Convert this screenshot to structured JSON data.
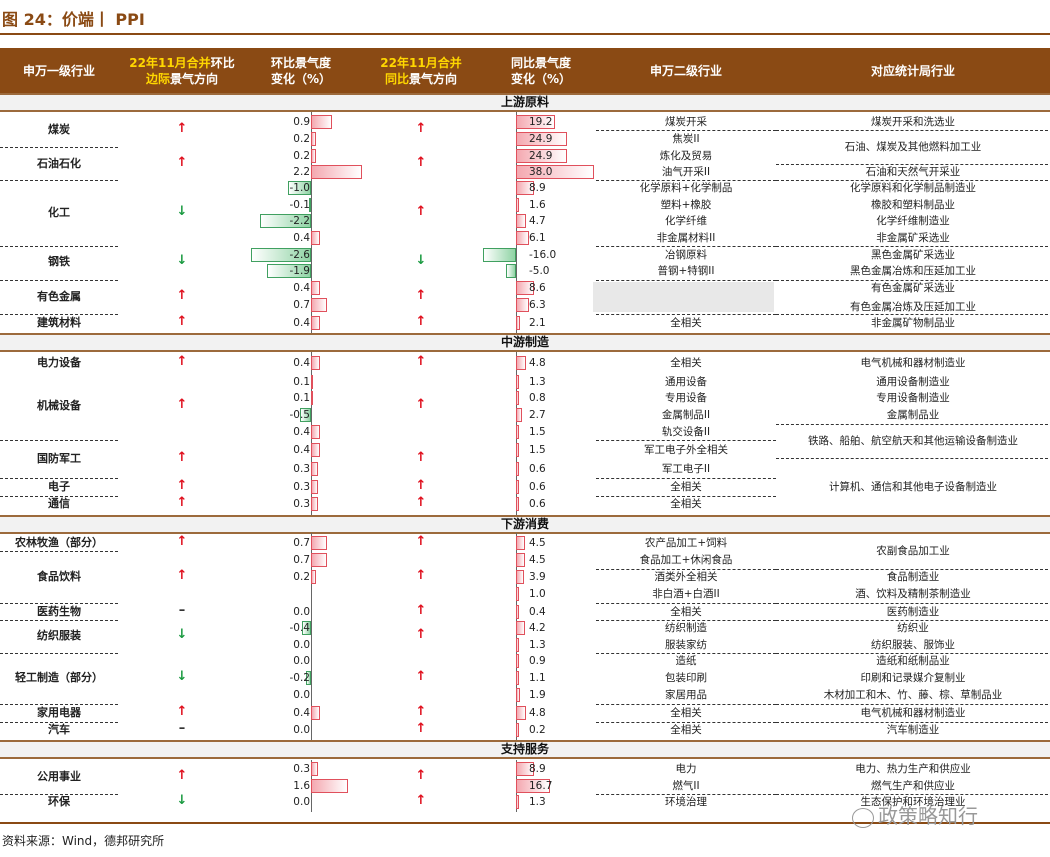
{
  "title": "图 24：价端丨 PPI",
  "footer": "资料来源：Wind，德邦研究所",
  "watermark": "政策略知行",
  "headers": [
    {
      "parts": [
        {
          "t": "申万一级行业",
          "hl": false
        }
      ]
    },
    {
      "parts": [
        {
          "t": "22年11月合并",
          "hl": true
        },
        {
          "t": "环比\n",
          "hl": false
        },
        {
          "t": "边际",
          "hl": true
        },
        {
          "t": "景气方向",
          "hl": false
        }
      ]
    },
    {
      "parts": [
        {
          "t": "环比景气度\n变化（%）",
          "hl": false
        }
      ]
    },
    {
      "parts": [
        {
          "t": "22年11月合并\n",
          "hl": true
        },
        {
          "t": "同比",
          "hl": true
        },
        {
          "t": "景气方向",
          "hl": false
        }
      ]
    },
    {
      "parts": [
        {
          "t": "同比景气度\n变化（%）",
          "hl": false
        }
      ]
    },
    {
      "parts": [
        {
          "t": "申万二级行业",
          "hl": false
        }
      ]
    },
    {
      "parts": [
        {
          "t": "对应统计局行业",
          "hl": false
        }
      ]
    }
  ],
  "sections": [
    "上游原料",
    "中游制造",
    "下游消费",
    "支持服务"
  ],
  "level1": [
    {
      "name": "煤炭",
      "mom": "up",
      "yoy": "up"
    },
    {
      "name": "石油石化",
      "mom": "up",
      "yoy": "up"
    },
    {
      "name": "化工",
      "mom": "down",
      "yoy": "up"
    },
    {
      "name": "钢铁",
      "mom": "down",
      "yoy": "down"
    },
    {
      "name": "有色金属",
      "mom": "up",
      "yoy": "up"
    },
    {
      "name": "建筑材料",
      "mom": "up",
      "yoy": "up"
    },
    {
      "name": "电力设备",
      "mom": "up",
      "yoy": "up"
    },
    {
      "name": "机械设备",
      "mom": "up",
      "yoy": "up"
    },
    {
      "name": "国防军工",
      "mom": "up",
      "yoy": "up"
    },
    {
      "name": "电子",
      "mom": "up",
      "yoy": "up"
    },
    {
      "name": "通信",
      "mom": "up",
      "yoy": "up"
    },
    {
      "name": "农林牧渔（部分）",
      "mom": "up",
      "yoy": "up"
    },
    {
      "name": "食品饮料",
      "mom": "up",
      "yoy": "up"
    },
    {
      "name": "医药生物",
      "mom": "flat",
      "yoy": "up"
    },
    {
      "name": "纺织服装",
      "mom": "down",
      "yoy": "up"
    },
    {
      "name": "轻工制造（部分）",
      "mom": "down",
      "yoy": "up"
    },
    {
      "name": "家用电器",
      "mom": "up",
      "yoy": "up"
    },
    {
      "name": "汽车",
      "mom": "flat",
      "yoy": "up"
    },
    {
      "name": "公用事业",
      "mom": "up",
      "yoy": "up"
    },
    {
      "name": "环保",
      "mom": "down",
      "yoy": "up"
    }
  ],
  "arrow_glyphs": {
    "up": "↑",
    "down": "↓",
    "flat": "–"
  },
  "level2": [
    {
      "mom": 0.9,
      "mom_label": "0.9",
      "yoy": 19.2,
      "yoy_label": "19.2",
      "name": "煤炭开采"
    },
    {
      "mom": 0.2,
      "mom_label": "0.2",
      "yoy": 24.9,
      "yoy_label": "24.9",
      "name": "焦炭II"
    },
    {
      "mom": 0.2,
      "mom_label": "0.2",
      "yoy": 24.9,
      "yoy_label": "24.9",
      "name": "炼化及贸易"
    },
    {
      "mom": 2.2,
      "mom_label": "2.2",
      "yoy": 38.0,
      "yoy_label": "38.0",
      "name": "油气开采II"
    },
    {
      "mom": -1.0,
      "mom_label": "-1.0",
      "yoy": 8.9,
      "yoy_label": "8.9",
      "name": "化学原料+化学制品"
    },
    {
      "mom": -0.1,
      "mom_label": "-0.1",
      "yoy": 1.6,
      "yoy_label": "1.6",
      "name": "塑料+橡胶"
    },
    {
      "mom": -2.2,
      "mom_label": "-2.2",
      "yoy": 4.7,
      "yoy_label": "4.7",
      "name": "化学纤维"
    },
    {
      "mom": 0.4,
      "mom_label": "0.4",
      "yoy": 6.1,
      "yoy_label": "6.1",
      "name": "非金属材料II"
    },
    {
      "mom": -2.6,
      "mom_label": "-2.6",
      "yoy": -16.0,
      "yoy_label": "-16.0",
      "name": "冶钢原料"
    },
    {
      "mom": -1.9,
      "mom_label": "-1.9",
      "yoy": -5.0,
      "yoy_label": "-5.0",
      "name": "普钢+特钢II"
    },
    {
      "mom": 0.4,
      "mom_label": "0.4",
      "yoy": 8.6,
      "yoy_label": "8.6",
      "name": ""
    },
    {
      "mom": 0.7,
      "mom_label": "0.7",
      "yoy": 6.3,
      "yoy_label": "6.3",
      "name": ""
    },
    {
      "mom": 0.4,
      "mom_label": "0.4",
      "yoy": 2.1,
      "yoy_label": "2.1",
      "name": "全相关"
    },
    {
      "mom": 0.4,
      "mom_label": "0.4",
      "yoy": 4.8,
      "yoy_label": "4.8",
      "name": "全相关"
    },
    {
      "mom": 0.1,
      "mom_label": "0.1",
      "yoy": 1.3,
      "yoy_label": "1.3",
      "name": "通用设备"
    },
    {
      "mom": 0.1,
      "mom_label": "0.1",
      "yoy": 0.8,
      "yoy_label": "0.8",
      "name": "专用设备"
    },
    {
      "mom": -0.5,
      "mom_label": "-0.5",
      "yoy": 2.7,
      "yoy_label": "2.7",
      "name": "金属制品II"
    },
    {
      "mom": 0.4,
      "mom_label": "0.4",
      "yoy": 1.5,
      "yoy_label": "1.5",
      "name": "轨交设备II"
    },
    {
      "mom": 0.4,
      "mom_label": "0.4",
      "yoy": 1.5,
      "yoy_label": "1.5",
      "name": "军工电子外全相关"
    },
    {
      "mom": 0.3,
      "mom_label": "0.3",
      "yoy": 0.6,
      "yoy_label": "0.6",
      "name": "军工电子II"
    },
    {
      "mom": 0.3,
      "mom_label": "0.3",
      "yoy": 0.6,
      "yoy_label": "0.6",
      "name": "全相关"
    },
    {
      "mom": 0.3,
      "mom_label": "0.3",
      "yoy": 0.6,
      "yoy_label": "0.6",
      "name": "全相关"
    },
    {
      "mom": 0.7,
      "mom_label": "0.7",
      "yoy": 4.5,
      "yoy_label": "4.5",
      "name": "农产品加工+饲料"
    },
    {
      "mom": 0.7,
      "mom_label": "0.7",
      "yoy": 4.5,
      "yoy_label": "4.5",
      "name": "食品加工+休闲食品"
    },
    {
      "mom": 0.2,
      "mom_label": "0.2",
      "yoy": 3.9,
      "yoy_label": "3.9",
      "name": "酒类外全相关"
    },
    {
      "mom": null,
      "mom_label": "",
      "yoy": 1.0,
      "yoy_label": "1.0",
      "name": "非白酒+白酒II"
    },
    {
      "mom": 0.0,
      "mom_label": "0.0",
      "yoy": 0.4,
      "yoy_label": "0.4",
      "name": "全相关"
    },
    {
      "mom": -0.4,
      "mom_label": "-0.4",
      "yoy": 4.2,
      "yoy_label": "4.2",
      "name": "纺织制造"
    },
    {
      "mom": 0.0,
      "mom_label": "0.0",
      "yoy": 1.3,
      "yoy_label": "1.3",
      "name": "服装家纺"
    },
    {
      "mom": 0.0,
      "mom_label": "0.0",
      "yoy": 0.9,
      "yoy_label": "0.9",
      "name": "造纸"
    },
    {
      "mom": -0.2,
      "mom_label": "-0.2",
      "yoy": 1.1,
      "yoy_label": "1.1",
      "name": "包装印刷"
    },
    {
      "mom": 0.0,
      "mom_label": "0.0",
      "yoy": 1.9,
      "yoy_label": "1.9",
      "name": "家居用品"
    },
    {
      "mom": 0.4,
      "mom_label": "0.4",
      "yoy": 4.8,
      "yoy_label": "4.8",
      "name": "全相关"
    },
    {
      "mom": 0.0,
      "mom_label": "0.0",
      "yoy": 0.2,
      "yoy_label": "0.2",
      "name": "全相关"
    },
    {
      "mom": 0.3,
      "mom_label": "0.3",
      "yoy": 8.9,
      "yoy_label": "8.9",
      "name": "电力"
    },
    {
      "mom": 1.6,
      "mom_label": "1.6",
      "yoy": 16.7,
      "yoy_label": "16.7",
      "name": "燃气II"
    },
    {
      "mom": 0.0,
      "mom_label": "0.0",
      "yoy": 1.3,
      "yoy_label": "1.3",
      "name": "环境治理"
    }
  ],
  "bureau": [
    "煤炭开采和洗选业",
    "石油、煤炭及其他燃料加工业",
    "石油和天然气开采业",
    "化学原料和化学制品制造业",
    "橡胶和塑料制品业",
    "化学纤维制造业",
    "非金属矿采选业",
    "黑色金属矿采选业",
    "黑色金属冶炼和压延加工业",
    "有色金属矿采选业",
    "有色金属冶炼及压延加工业",
    "非金属矿物制品业",
    "电气机械和器材制造业",
    "通用设备制造业",
    "专用设备制造业",
    "金属制品业",
    "铁路、船舶、航空航天和其他运输设备制造业",
    "计算机、通信和其他电子设备制造业",
    "农副食品加工业",
    "食品制造业",
    "酒、饮料及精制茶制造业",
    "医药制造业",
    "纺织业",
    "纺织服装、服饰业",
    "造纸和纸制品业",
    "印刷和记录媒介复制业",
    "木材加工和木、竹、藤、棕、草制品业",
    "电气机械和器材制造业",
    "汽车制造业",
    "电力、热力生产和供应业",
    "燃气生产和供应业",
    "生态保护和环境治理业"
  ]
}
